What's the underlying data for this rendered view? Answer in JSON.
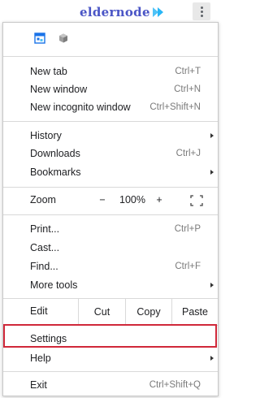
{
  "brand": {
    "logo_text": "eldernode",
    "logo_color": "#4a55c6"
  },
  "menu": {
    "extensions": [
      "translate-extension-icon",
      "puzzle-extension-icon"
    ],
    "items": {
      "new_tab": {
        "label": "New tab",
        "shortcut": "Ctrl+T"
      },
      "new_window": {
        "label": "New window",
        "shortcut": "Ctrl+N"
      },
      "new_incognito": {
        "label": "New incognito window",
        "shortcut": "Ctrl+Shift+N"
      },
      "history": {
        "label": "History"
      },
      "downloads": {
        "label": "Downloads",
        "shortcut": "Ctrl+J"
      },
      "bookmarks": {
        "label": "Bookmarks"
      },
      "print": {
        "label": "Print...",
        "shortcut": "Ctrl+P"
      },
      "cast": {
        "label": "Cast..."
      },
      "find": {
        "label": "Find...",
        "shortcut": "Ctrl+F"
      },
      "more_tools": {
        "label": "More tools"
      },
      "settings": {
        "label": "Settings"
      },
      "help": {
        "label": "Help"
      },
      "exit": {
        "label": "Exit",
        "shortcut": "Ctrl+Shift+Q"
      }
    },
    "zoom": {
      "label": "Zoom",
      "minus": "−",
      "value": "100%",
      "plus": "+"
    },
    "edit": {
      "label": "Edit",
      "cut": "Cut",
      "copy": "Copy",
      "paste": "Paste"
    },
    "highlight_color": "#d0283a"
  }
}
